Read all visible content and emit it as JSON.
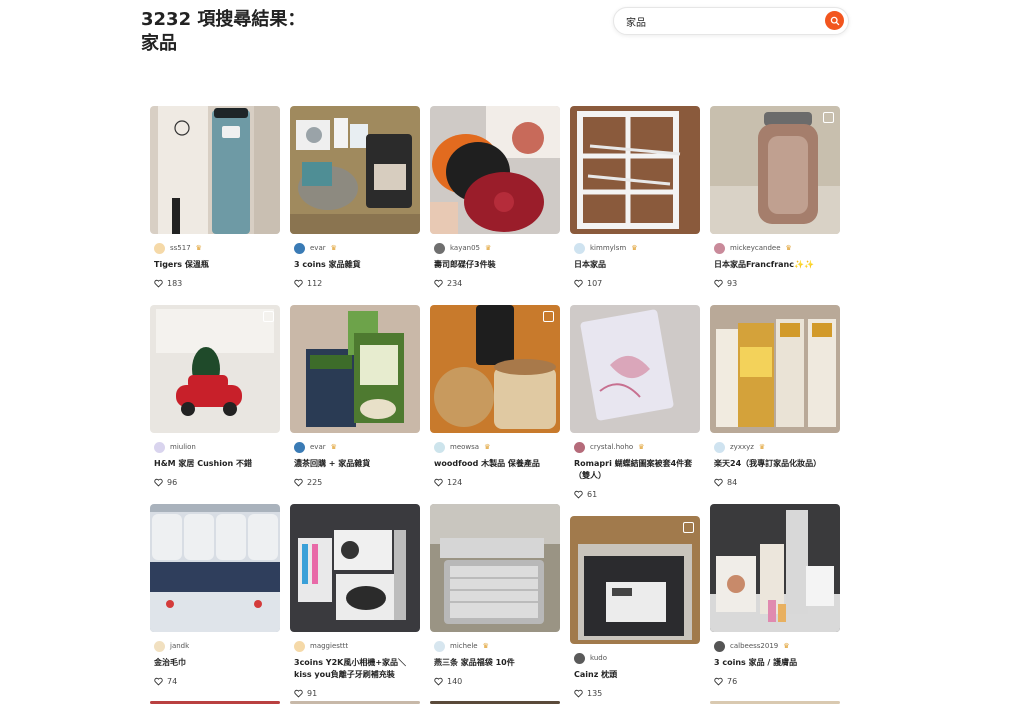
{
  "header": {
    "count": "3232",
    "title_line1": "3232 項搜尋結果：",
    "title_line2": "家品"
  },
  "search": {
    "value": "家品",
    "icon": "search-icon"
  },
  "cards": [
    {
      "user": "ss517",
      "crown": true,
      "title": "Tigers 保溫瓶",
      "likes": "183",
      "avatar_color": "#f5d9a8",
      "multi": false
    },
    {
      "user": "evar",
      "crown": true,
      "title": "3 coins 家品雜貨",
      "likes": "112",
      "avatar_color": "#3a7bb5",
      "multi": false
    },
    {
      "user": "kayan05",
      "crown": true,
      "title": "壽司郎碟仔3件裝",
      "likes": "234",
      "avatar_color": "#6f6f6f",
      "multi": false
    },
    {
      "user": "kimmylsm",
      "crown": true,
      "title": "日本家品",
      "likes": "107",
      "avatar_color": "#cfe3f0",
      "multi": false
    },
    {
      "user": "mickeycandee",
      "crown": true,
      "title": "日本家品Francfranc✨✨",
      "likes": "93",
      "avatar_color": "#c98a9a",
      "multi": true
    },
    {
      "user": "miulion",
      "crown": false,
      "title": "H&M 家居 Cushion 不錯",
      "likes": "96",
      "avatar_color": "#d9d4ee",
      "multi": true
    },
    {
      "user": "evar",
      "crown": true,
      "title": "濃茶回購 + 家品雜貨",
      "likes": "225",
      "avatar_color": "#3a7bb5",
      "multi": false
    },
    {
      "user": "meowsa",
      "crown": true,
      "title": "woodfood 木製品 保養產品",
      "likes": "124",
      "avatar_color": "#cde4ec",
      "multi": true
    },
    {
      "user": "crystal.hoho",
      "crown": true,
      "title": "Romapri 蝴蝶結圖案被套4件套（雙人）",
      "likes": "61",
      "avatar_color": "#b56b7a",
      "multi": false
    },
    {
      "user": "zyxxyz",
      "crown": true,
      "title": "楽天24（我專訂家品化妝品）",
      "likes": "84",
      "avatar_color": "#cfe3f0",
      "multi": false
    },
    {
      "user": "jandk",
      "crown": false,
      "title": "金治毛巾",
      "likes": "74",
      "avatar_color": "#f1e0c0",
      "multi": false
    },
    {
      "user": "maggiesttt",
      "crown": false,
      "title": "3coins Y2K風小相機+家品＼kiss you負離子牙刷補充裝",
      "likes": "91",
      "avatar_color": "#f5d9a8",
      "multi": false
    },
    {
      "user": "michele",
      "crown": true,
      "title": "燕三条 家品福袋 10件",
      "likes": "140",
      "avatar_color": "#d7e6ef",
      "multi": false
    },
    {
      "user": "kudo",
      "crown": false,
      "title": "Cainz 枕頭",
      "likes": "135",
      "avatar_color": "#5a5a5a",
      "multi": true
    },
    {
      "user": "calbeess2019",
      "crown": true,
      "title": "3 coins 家品 / 護膚品",
      "likes": "76",
      "avatar_color": "#555555",
      "multi": false
    }
  ]
}
